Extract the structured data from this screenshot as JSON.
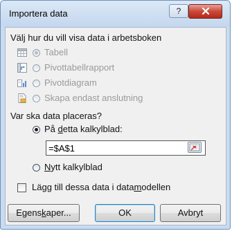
{
  "window": {
    "title": "Importera data",
    "help_label": "?",
    "close_label": "x"
  },
  "view_section": {
    "heading": "Välj hur du vill visa data i arbetsboken",
    "options": [
      {
        "label": "Tabell",
        "icon": "table-icon",
        "selected": true,
        "enabled": false
      },
      {
        "label": "Pivottabellrapport",
        "icon": "pivottable-icon",
        "selected": false,
        "enabled": false
      },
      {
        "label": "Pivotdiagram",
        "icon": "pivotchart-icon",
        "selected": false,
        "enabled": false
      },
      {
        "label": "Skapa endast anslutning",
        "icon": "connection-icon",
        "selected": false,
        "enabled": false
      }
    ]
  },
  "location_section": {
    "heading": "Var ska data placeras?",
    "existing_sheet": {
      "prefix": "På ",
      "mnemonic": "d",
      "suffix": "etta kalkylblad:",
      "selected": true
    },
    "range_value": "=$A$1",
    "new_sheet": {
      "mnemonic": "N",
      "suffix": "ytt kalkylblad",
      "selected": false
    }
  },
  "data_model": {
    "prefix": "Lägg till dessa data i data",
    "mnemonic": "m",
    "suffix": "odellen",
    "checked": false
  },
  "buttons": {
    "properties": {
      "prefix": "Egens",
      "mnemonic": "k",
      "suffix": "aper..."
    },
    "ok": "OK",
    "cancel": "Avbryt"
  },
  "colors": {
    "frame": "#c9dbef",
    "content_bg": "#f0f0f0",
    "close_red": "#c9493a",
    "default_button_border": "#3c7fb1"
  }
}
